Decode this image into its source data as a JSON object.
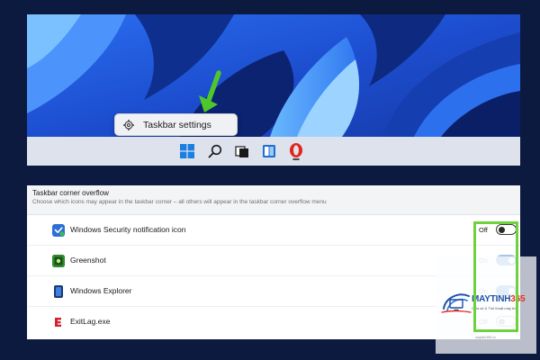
{
  "taskbar": {
    "context_menu_label": "Taskbar settings",
    "icons": [
      "start-icon",
      "search-icon",
      "task-view-icon",
      "widgets-icon",
      "opera-browser-icon"
    ],
    "accent_arrow_color": "#4fc62b"
  },
  "settings": {
    "section_title": "Taskbar corner overflow",
    "section_subtitle": "Choose which icons may appear in the taskbar corner – all others will appear in the taskbar corner overflow menu",
    "items": [
      {
        "label": "Windows Security notification icon",
        "icon": "windows-security-icon",
        "state": "Off",
        "enabled": false
      },
      {
        "label": "Greenshot",
        "icon": "greenshot-icon",
        "state": "On",
        "enabled": true
      },
      {
        "label": "Windows Explorer",
        "icon": "windows-explorer-icon",
        "state": "On",
        "enabled": true
      },
      {
        "label": "ExitLag.exe",
        "icon": "exitlag-icon",
        "state": "Off",
        "enabled": false
      }
    ]
  },
  "watermark": {
    "brand_main": "MAYTINH",
    "brand_accent": "365",
    "tagline": "Chia sẻ & Thủ thuật máy tính",
    "site": "maytinh365.vn"
  },
  "colors": {
    "page_background": "#0c1a40",
    "highlight": "#6fd13c",
    "toggle_on": "#a7c4e6",
    "brand_blue": "#1e4fa3",
    "brand_red": "#e5301d"
  }
}
